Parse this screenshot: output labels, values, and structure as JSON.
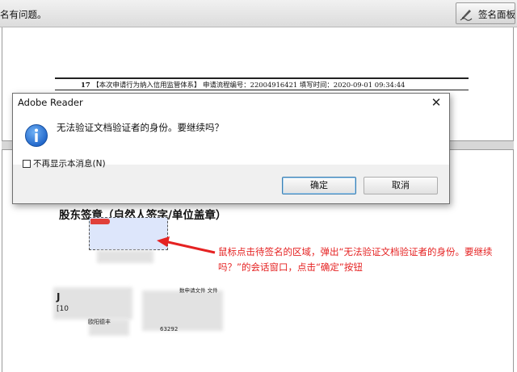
{
  "toolbar": {
    "message": "名有问题。",
    "sign_panel_label": "签名面板",
    "sign_panel_icon": "pen-signature-icon"
  },
  "document": {
    "header": {
      "page_no": "17",
      "bracket_text": "【本次申请行为纳入信用监管体系】",
      "flow_label": "申请流程编号：22004916421",
      "fill_time": "填写时间：2020-09-01 09:34:44"
    },
    "shareholder_title": "股东签章（自然人签字/单位盖章）",
    "annotation": "鼠标点击待签名的区域，弹出“无法验证文档验证者的身份。要继续吗？”的会话窗口，点击“确定”按钮",
    "fragments": {
      "f1": "J",
      "f2": "[10",
      "f3": "欧阳德丰",
      "f4": "数申请文件 文件",
      "f5": "63292"
    }
  },
  "dialog": {
    "title": "Adobe Reader",
    "close_glyph": "✕",
    "message": "无法验证文档验证者的身份。要继续吗？",
    "checkbox_label": "不再显示本消息(N)",
    "checkbox_checked": false,
    "ok_label": "确定",
    "cancel_label": "取消",
    "icon": "info-icon"
  },
  "colors": {
    "annotation": "#e52222",
    "signature_field": "#dde6fb",
    "info_blue": "#1f64c8"
  }
}
